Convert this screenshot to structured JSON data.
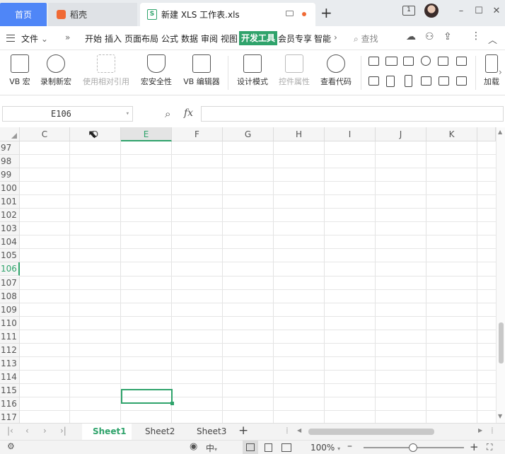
{
  "titlebar": {
    "home_tab": "首页",
    "daoke_tab": "稻壳",
    "doc_tab": "新建 XLS 工作表.xls",
    "new_tab": "+",
    "badge": "1"
  },
  "menubar": {
    "file": "文件",
    "items": [
      "开始",
      "插入",
      "页面布局",
      "公式",
      "数据",
      "审阅",
      "视图",
      "开发工具",
      "会员专享",
      "智能"
    ],
    "search": "查找"
  },
  "ribbon": {
    "buttons": [
      "VB 宏",
      "录制新宏",
      "使用相对引用",
      "宏安全性",
      "VB 编辑器",
      "设计模式",
      "控件属性",
      "查看代码"
    ],
    "addin": "加载"
  },
  "formula": {
    "namebox": "E106",
    "fx": "fx",
    "value": ""
  },
  "grid": {
    "columns": [
      "C",
      "D",
      "E",
      "F",
      "G",
      "H",
      "I",
      "J",
      "K"
    ],
    "rows": [
      "97",
      "98",
      "99",
      "100",
      "101",
      "102",
      "103",
      "104",
      "105",
      "106",
      "107",
      "108",
      "109",
      "110",
      "111",
      "112",
      "113",
      "114",
      "115",
      "116",
      "117"
    ],
    "active_column": "E",
    "active_row": "106"
  },
  "sheets": [
    "Sheet1",
    "Sheet2",
    "Sheet3"
  ],
  "status": {
    "zoom": "100%",
    "input_mode": "中"
  },
  "colors": {
    "accent": "#2fa36b",
    "home_tab": "#4f86f7"
  }
}
